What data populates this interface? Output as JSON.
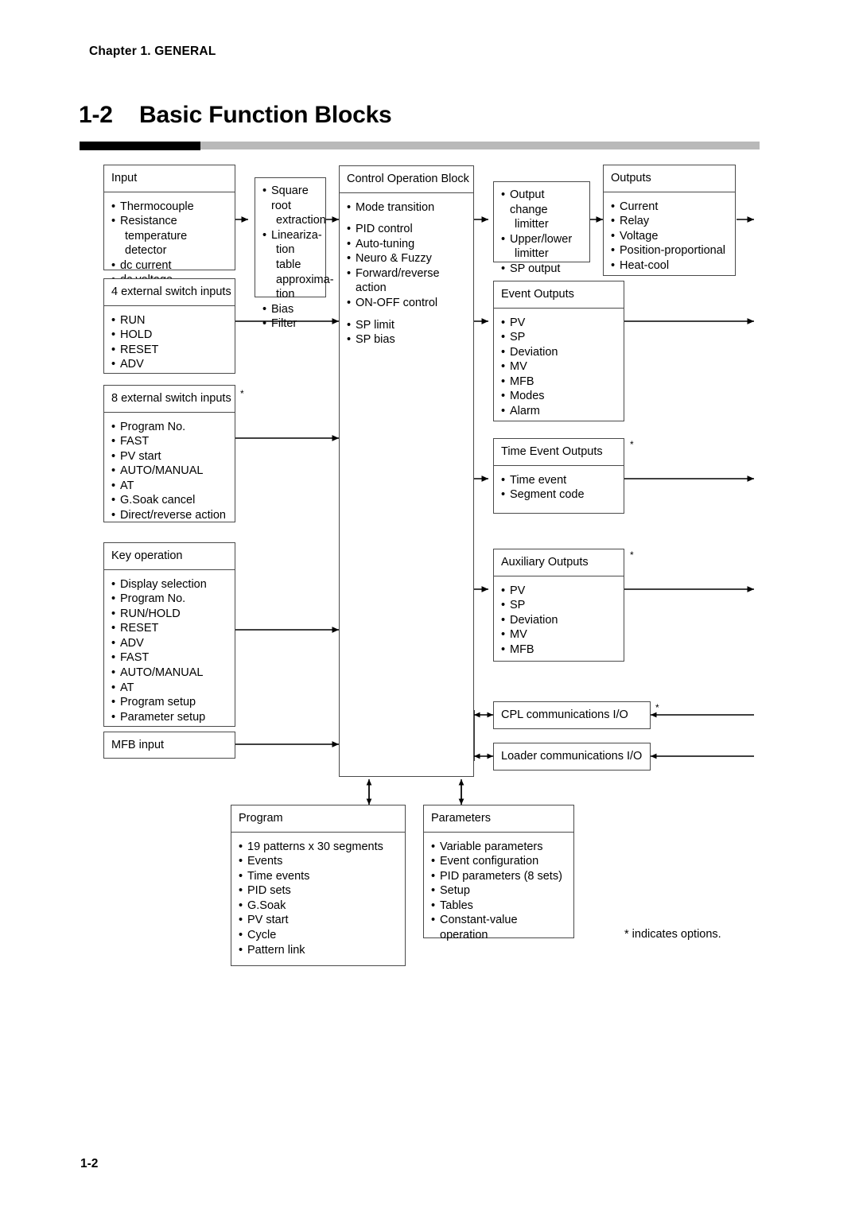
{
  "page": {
    "chapter": "Chapter 1. GENERAL",
    "section_number": "1-2",
    "section_title": "Basic Function Blocks",
    "page_number": "1-2",
    "footnote": "* indicates options.",
    "option_marker": "*"
  },
  "colors": {
    "rule_black": "#000000",
    "rule_gray": "#b9b9b9",
    "box_border": "#4a4a4a",
    "text": "#000000",
    "background": "#ffffff"
  },
  "blocks": {
    "input": {
      "title": "Input",
      "items": [
        "Thermocouple",
        "Resistance",
        "temperature detector",
        "dc current",
        "dc voltage"
      ]
    },
    "preprocess": {
      "title": "",
      "items": [
        "Square root",
        "extraction",
        "Lineariza-",
        "tion table",
        "approxima-",
        "tion",
        "Bias",
        "Filter"
      ]
    },
    "switch4": {
      "title": "4 external switch inputs",
      "items": [
        "RUN",
        "HOLD",
        "RESET",
        "ADV"
      ]
    },
    "switch8": {
      "title": "8 external switch inputs",
      "items": [
        "Program No.",
        "FAST",
        "PV start",
        "AUTO/MANUAL",
        "AT",
        "G.Soak cancel",
        "Direct/reverse action"
      ],
      "option": "*"
    },
    "key_operation": {
      "title": "Key operation",
      "items": [
        "Display selection",
        "Program No.",
        "RUN/HOLD",
        "RESET",
        "ADV",
        "FAST",
        "AUTO/MANUAL",
        "AT",
        "Program setup",
        "Parameter setup"
      ]
    },
    "mfb_input": {
      "title": "MFB input"
    },
    "control_operation": {
      "title": "Control Operation Block",
      "items": [
        "Mode transition",
        "PID control",
        "Auto-tuning",
        "Neuro & Fuzzy",
        "Forward/reverse action",
        "ON-OFF control",
        "SP limit",
        "SP bias"
      ]
    },
    "output_limiter": {
      "title": "",
      "items": [
        "Output change",
        "limitter",
        "Upper/lower",
        "limitter",
        "SP output"
      ]
    },
    "outputs": {
      "title": "Outputs",
      "items": [
        "Current",
        "Relay",
        "Voltage",
        "Position-proportional",
        "Heat-cool"
      ]
    },
    "event_outputs": {
      "title": "Event Outputs",
      "items": [
        "PV",
        "SP",
        "Deviation",
        "MV",
        "MFB",
        "Modes",
        "Alarm"
      ]
    },
    "time_event_outputs": {
      "title": "Time Event Outputs",
      "items": [
        "Time event",
        "Segment code"
      ],
      "option": "*"
    },
    "auxiliary_outputs": {
      "title": "Auxiliary Outputs",
      "items": [
        "PV",
        "SP",
        "Deviation",
        "MV",
        "MFB"
      ],
      "option": "*"
    },
    "cpl_comm": {
      "title": "CPL communications I/O",
      "option": "*"
    },
    "loader_comm": {
      "title": "Loader communications I/O"
    },
    "program": {
      "title": "Program",
      "items": [
        "19 patterns x 30 segments",
        "Events",
        "Time events",
        "PID sets",
        "G.Soak",
        "PV start",
        "Cycle",
        "Pattern link"
      ]
    },
    "parameters": {
      "title": "Parameters",
      "items": [
        "Variable parameters",
        "Event configuration",
        "PID parameters (8 sets)",
        "Setup",
        "Tables",
        "Constant-value operation"
      ]
    }
  }
}
